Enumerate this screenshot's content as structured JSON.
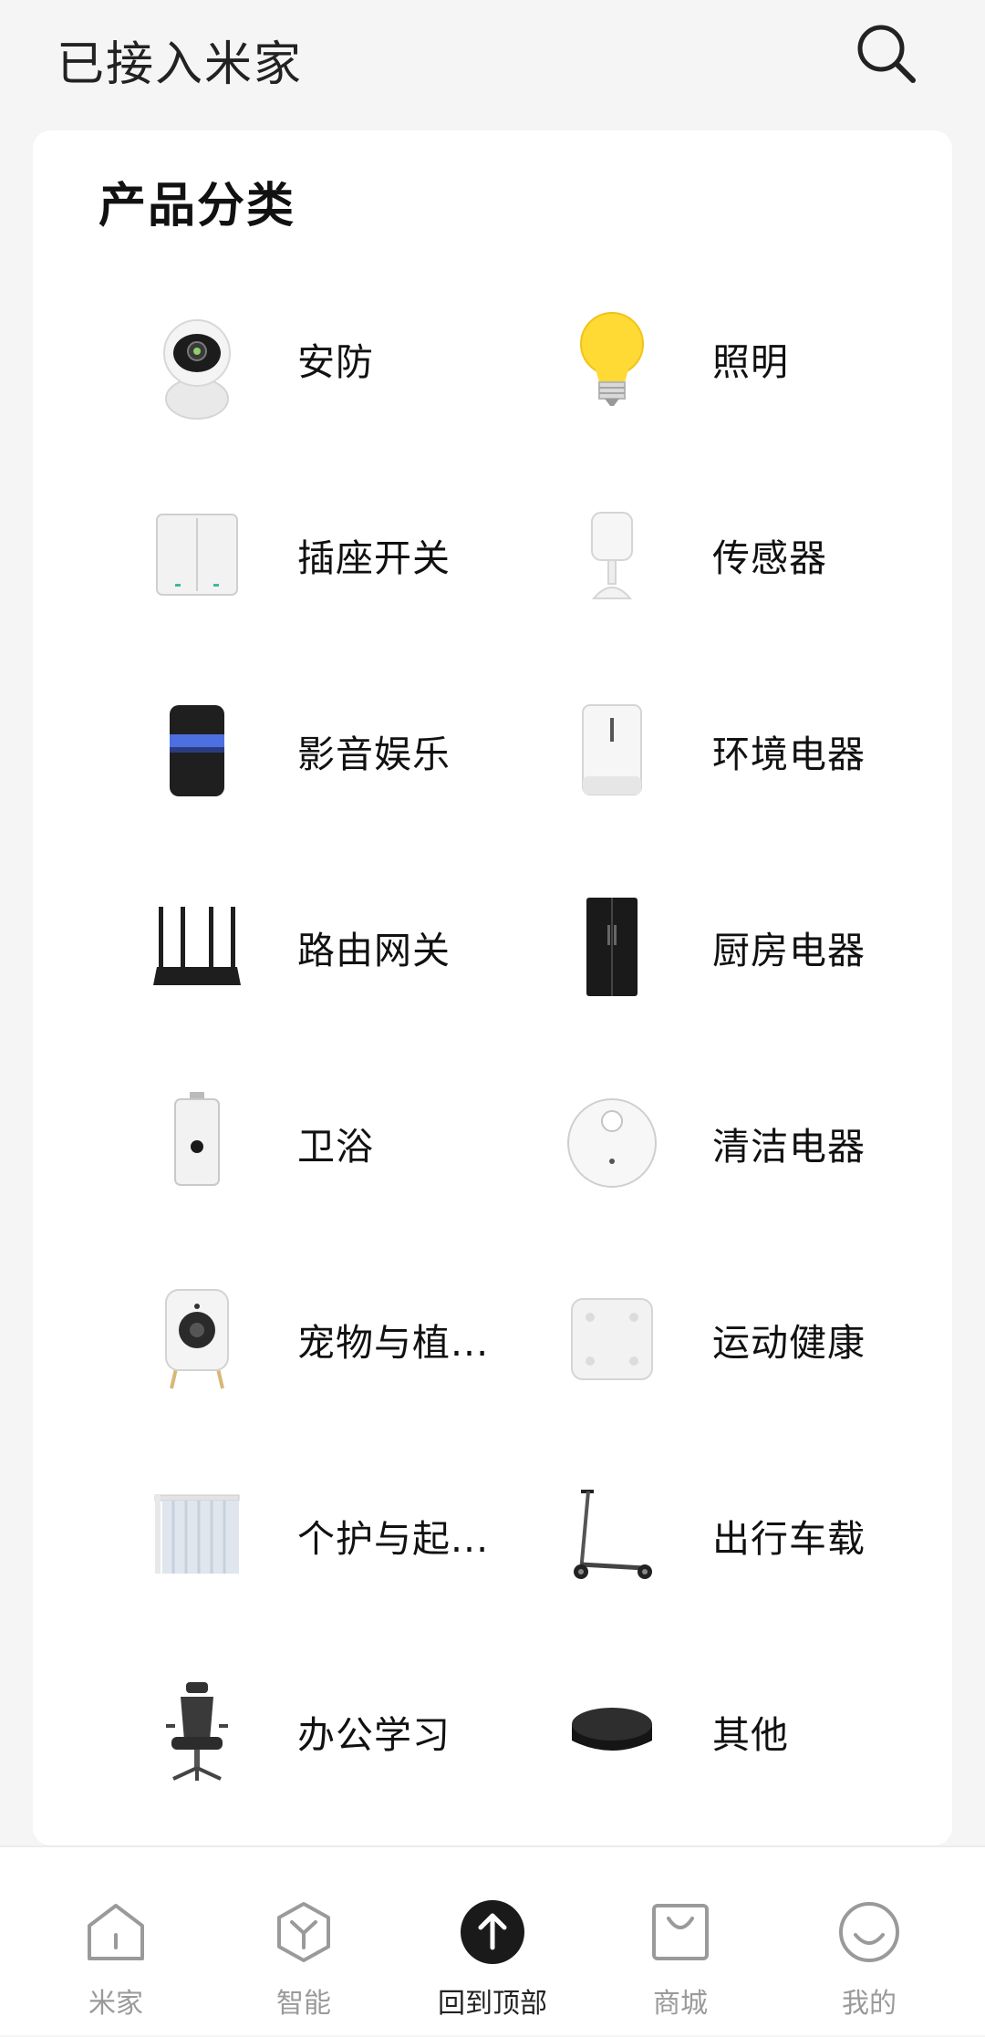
{
  "header": {
    "title": "已接入米家",
    "search_icon": "search-icon"
  },
  "category_card": {
    "title": "产品分类",
    "items": [
      {
        "label": "安防",
        "icon": "camera-icon"
      },
      {
        "label": "照明",
        "icon": "bulb-icon"
      },
      {
        "label": "插座开关",
        "icon": "wall-switch-icon"
      },
      {
        "label": "传感器",
        "icon": "motion-sensor-icon"
      },
      {
        "label": "影音娱乐",
        "icon": "speaker-icon"
      },
      {
        "label": "环境电器",
        "icon": "humidifier-icon"
      },
      {
        "label": "路由网关",
        "icon": "router-icon"
      },
      {
        "label": "厨房电器",
        "icon": "fridge-icon"
      },
      {
        "label": "卫浴",
        "icon": "water-heater-icon"
      },
      {
        "label": "清洁电器",
        "icon": "robot-vacuum-icon"
      },
      {
        "label": "宠物与植...",
        "icon": "pet-camera-icon"
      },
      {
        "label": "运动健康",
        "icon": "scale-icon"
      },
      {
        "label": "个护与起...",
        "icon": "curtain-icon"
      },
      {
        "label": "出行车载",
        "icon": "scooter-icon"
      },
      {
        "label": "办公学习",
        "icon": "office-chair-icon"
      },
      {
        "label": "其他",
        "icon": "ir-hub-icon"
      }
    ]
  },
  "bottom_nav": {
    "items": [
      {
        "label": "米家",
        "icon": "home-icon",
        "active": false
      },
      {
        "label": "智能",
        "icon": "smart-cube-icon",
        "active": false
      },
      {
        "label": "回到顶部",
        "icon": "arrow-up-icon",
        "active": true
      },
      {
        "label": "商城",
        "icon": "shopping-bag-icon",
        "active": false
      },
      {
        "label": "我的",
        "icon": "smile-face-icon",
        "active": false
      }
    ]
  },
  "colors": {
    "background": "#f5f5f5",
    "card": "#ffffff",
    "text_primary": "#111111",
    "text_inactive": "#9a9a9a",
    "bulb_yellow": "#ffd934"
  }
}
